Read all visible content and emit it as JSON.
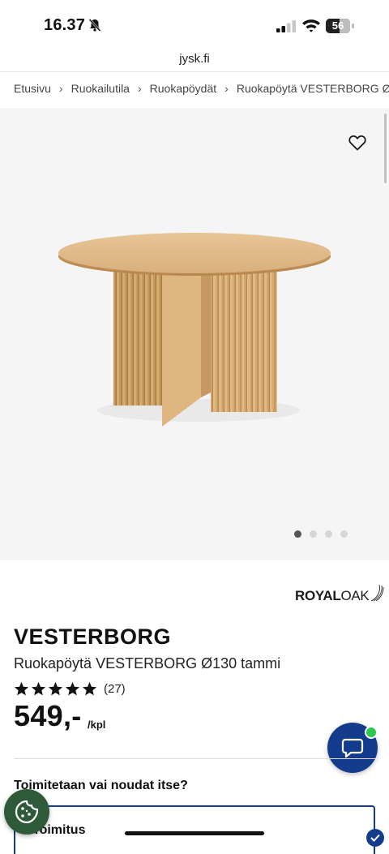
{
  "status_bar": {
    "time": "16.37",
    "battery_level": "56",
    "icons": [
      "bell-slash-icon",
      "signal-icon",
      "wifi-icon",
      "battery-icon"
    ]
  },
  "browser": {
    "url": "jysk.fi"
  },
  "breadcrumb": [
    {
      "label": "Etusivu"
    },
    {
      "label": "Ruokailutila"
    },
    {
      "label": "Ruokapöydät"
    },
    {
      "label": "Ruokapöytä VESTERBORG Ø"
    }
  ],
  "gallery": {
    "image": "round oak dining table with fluted pedestal base",
    "slide_count": 4,
    "active_slide": 1
  },
  "brand": {
    "name_bold": "ROYAL",
    "name_light": "OAK"
  },
  "product": {
    "name": "VESTERBORG",
    "subtitle": "Ruokapöytä VESTERBORG Ø130 tammi",
    "rating": 5,
    "review_count": "(27)",
    "price": "549,-",
    "unit": "/kpl"
  },
  "delivery": {
    "question": "Toimitetaan vai noudat itse?",
    "option_label": "Toimitus"
  },
  "colors": {
    "accent": "#143c8c",
    "chat_badge": "#2cc84d",
    "cookie_button": "#2f5a3a",
    "gallery_bg": "#f5f5f5"
  }
}
